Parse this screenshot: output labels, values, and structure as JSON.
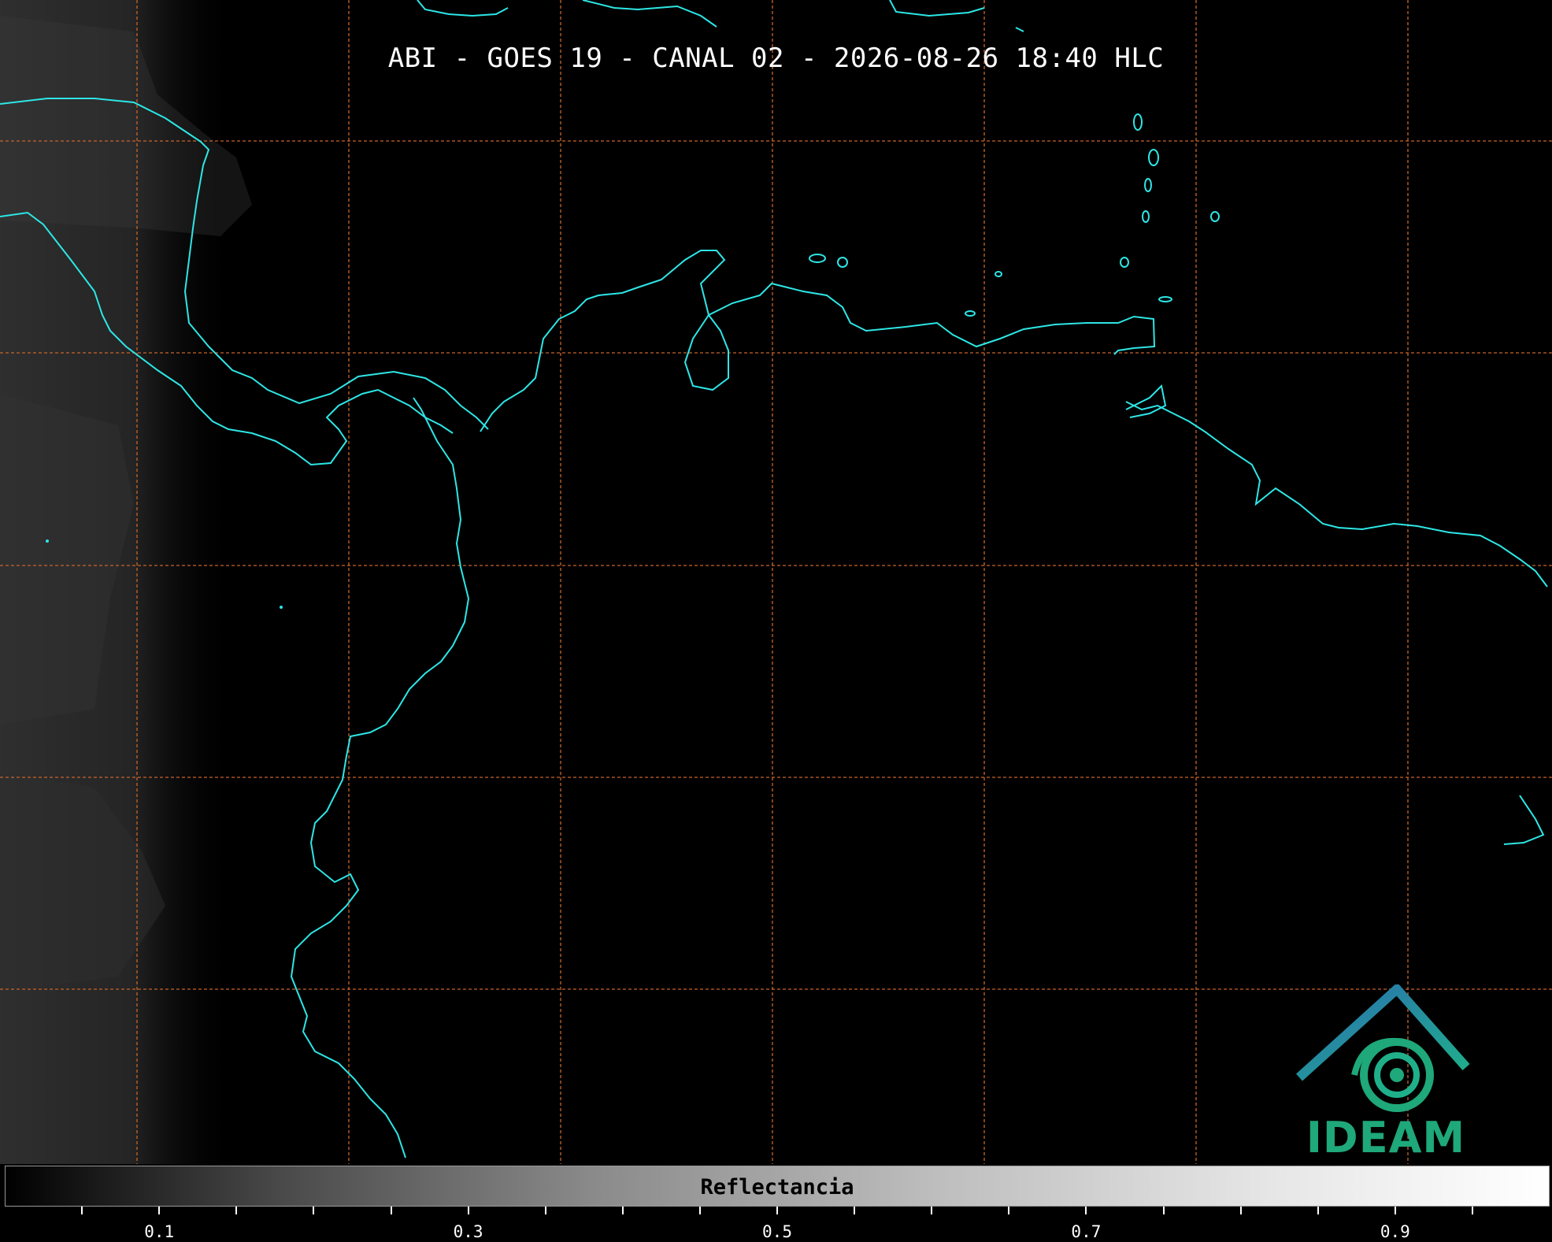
{
  "title": "ABI - GOES 19 - CANAL 02 - 2026-08-26 18:40 HLC",
  "colorbar": {
    "label": "Reflectancia",
    "range": [
      0.0,
      1.0
    ],
    "tick_labels": [
      "0.1",
      "0.3",
      "0.5",
      "0.7",
      "0.9"
    ],
    "tick_values": [
      0.1,
      0.3,
      0.5,
      0.7,
      0.9
    ],
    "colormap": "grayscale"
  },
  "logo": {
    "text": "IDEAM"
  },
  "colors": {
    "coastline": "#2ee6e6",
    "gridline": "#c8642a",
    "background": "#000000",
    "text": "#ffffff",
    "logo_green": "#1fa87a",
    "logo_blue": "#2a6fb0"
  }
}
